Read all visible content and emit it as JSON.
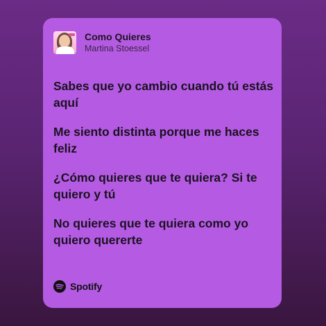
{
  "song": {
    "title": "Como Quieres",
    "artist": "Martina Stoessel"
  },
  "lyrics": [
    "Sabes que yo cambio cuando tú estás aquí",
    "Me siento distinta porque me haces feliz",
    "¿Cómo quieres que te quiera? Si te quiero y tú",
    "No quieres que te quiera como yo quiero quererte"
  ],
  "footer": {
    "brand": "Spotify",
    "icon": "spotify-icon"
  },
  "colors": {
    "card": "#b55be3",
    "background_top": "#6b2b86",
    "background_bottom": "#3a163f",
    "text": "#1a1220"
  }
}
